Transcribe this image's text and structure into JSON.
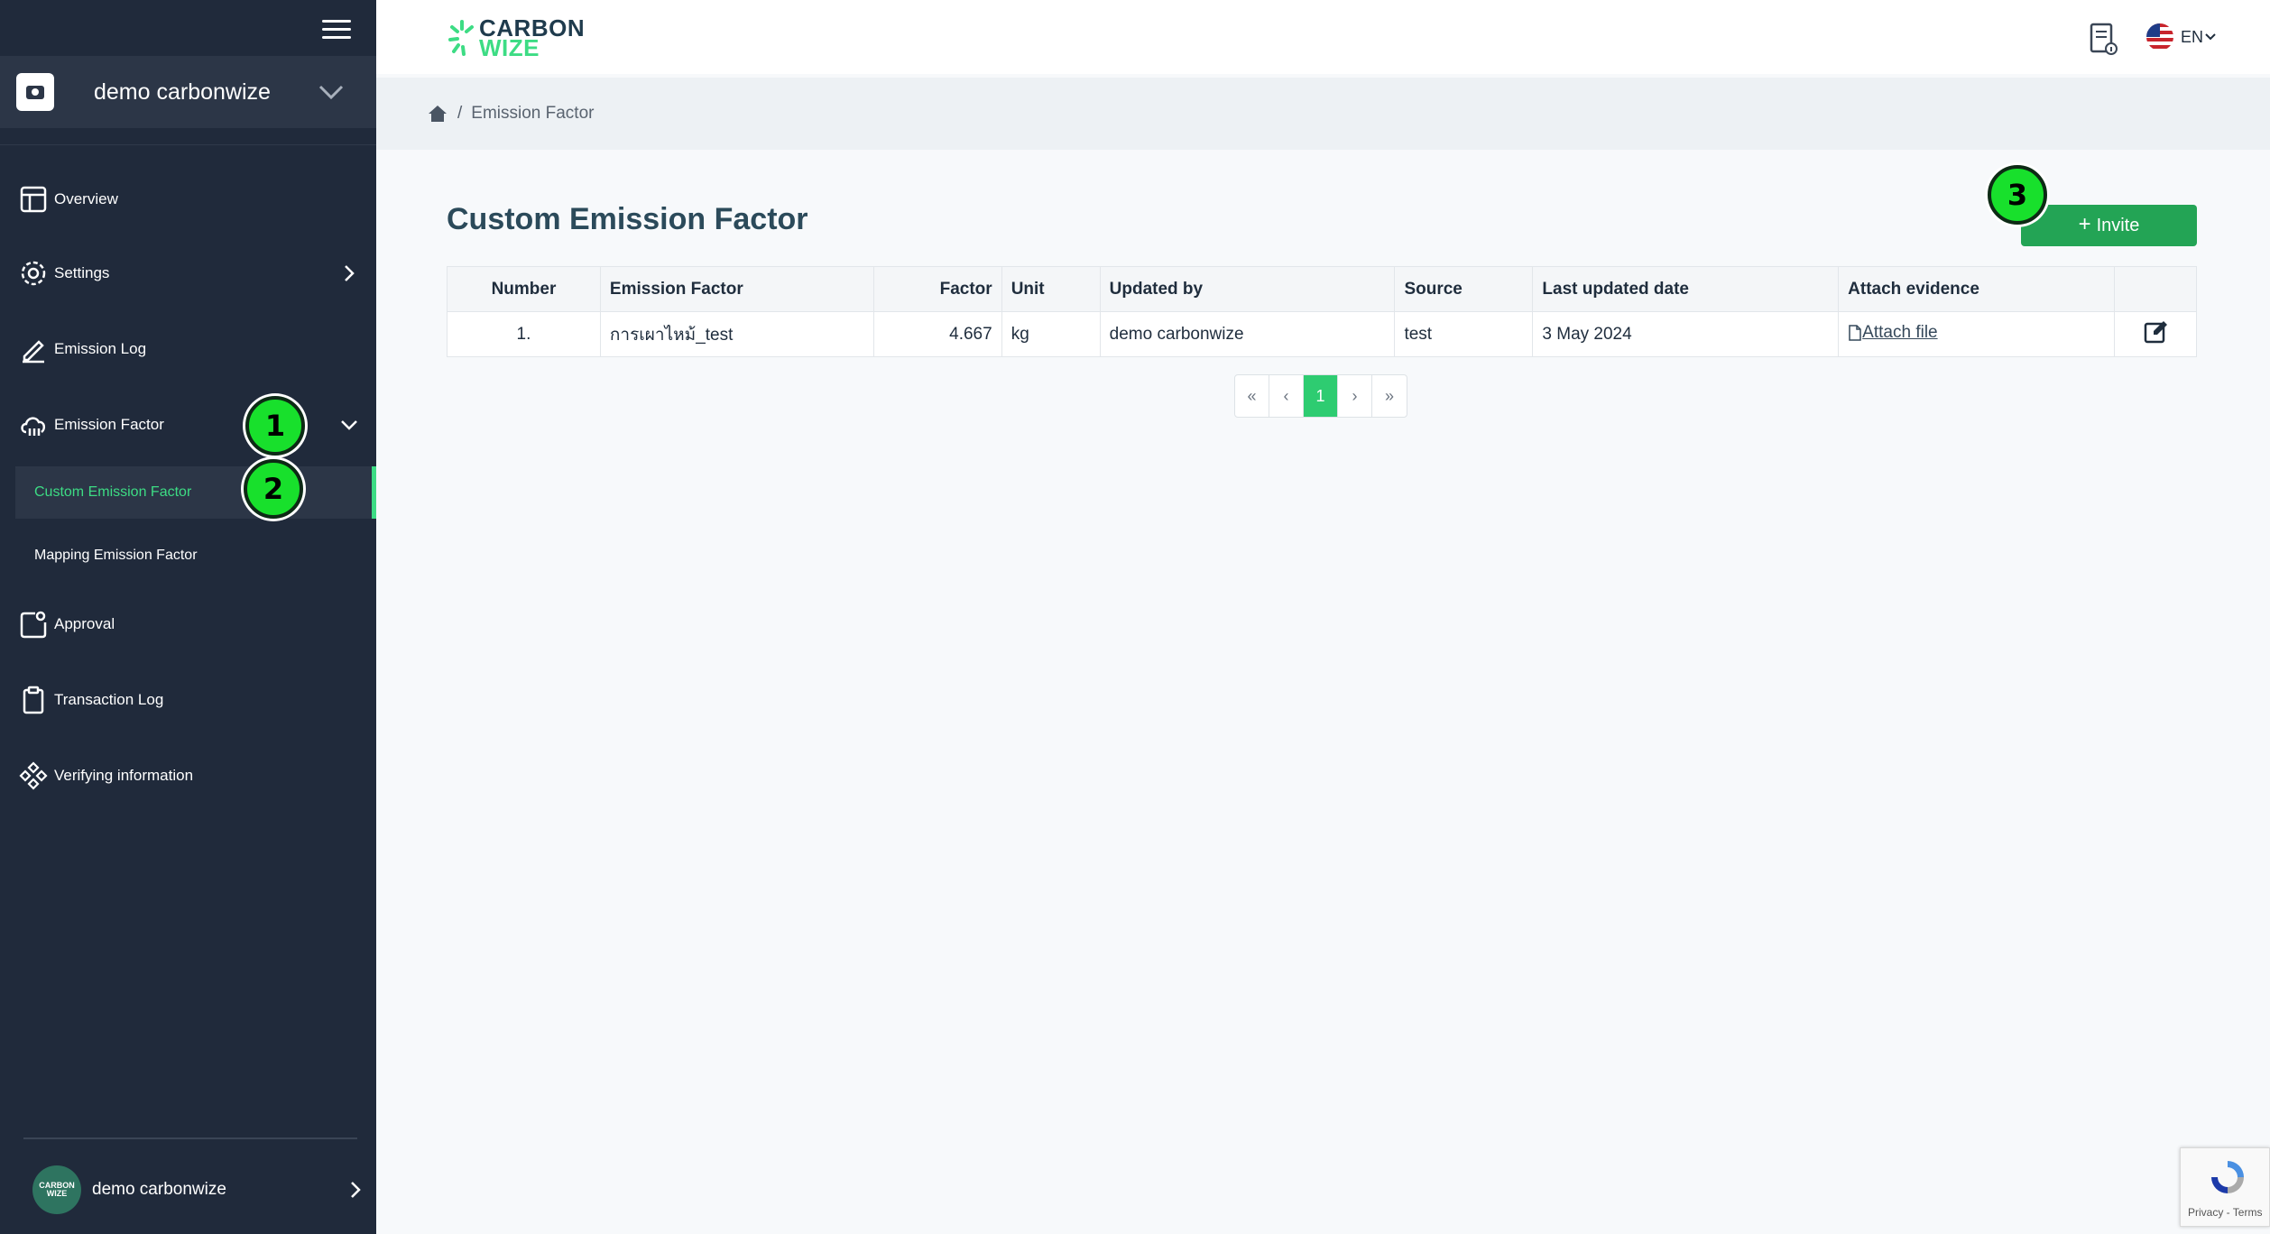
{
  "sidebar": {
    "org_name": "demo carbonwize",
    "items": [
      {
        "label": "Overview"
      },
      {
        "label": "Settings"
      },
      {
        "label": "Emission Log"
      },
      {
        "label": "Emission Factor"
      },
      {
        "label": "Approval"
      },
      {
        "label": "Transaction Log"
      },
      {
        "label": "Verifying information"
      }
    ],
    "subitems": [
      {
        "label": "Custom Emission Factor",
        "active": true
      },
      {
        "label": "Mapping Emission Factor",
        "active": false
      }
    ],
    "user": {
      "name": "demo carbonwize",
      "avatar_text": "CARBON WIZE"
    }
  },
  "markers": [
    "1",
    "2",
    "3"
  ],
  "header": {
    "logo_line1": "CARBON",
    "logo_line2": "WIZE",
    "language": "EN"
  },
  "breadcrumb": {
    "separator": "/",
    "current": "Emission Factor"
  },
  "main": {
    "title": "Custom Emission Factor",
    "invite_label": "Invite",
    "table": {
      "columns": [
        "Number",
        "Emission Factor",
        "Factor",
        "Unit",
        "Updated by",
        "Source",
        "Last updated date",
        "Attach evidence",
        ""
      ],
      "rows": [
        {
          "number": "1.",
          "emission_factor": "การเผาไหม้_test",
          "factor": "4.667",
          "unit": "kg",
          "updated_by": "demo carbonwize",
          "source": "test",
          "last_updated": "3 May 2024",
          "attach": "Attach file"
        }
      ]
    },
    "pagination": {
      "first": "«",
      "prev": "‹",
      "current": "1",
      "next": "›",
      "last": "»"
    }
  },
  "recaptcha": {
    "text": "Privacy - Terms"
  },
  "colors": {
    "sidebar_bg": "#202a3b",
    "accent_green": "#3ddc84",
    "button_green": "#23a455",
    "marker_green": "#18e02c"
  }
}
